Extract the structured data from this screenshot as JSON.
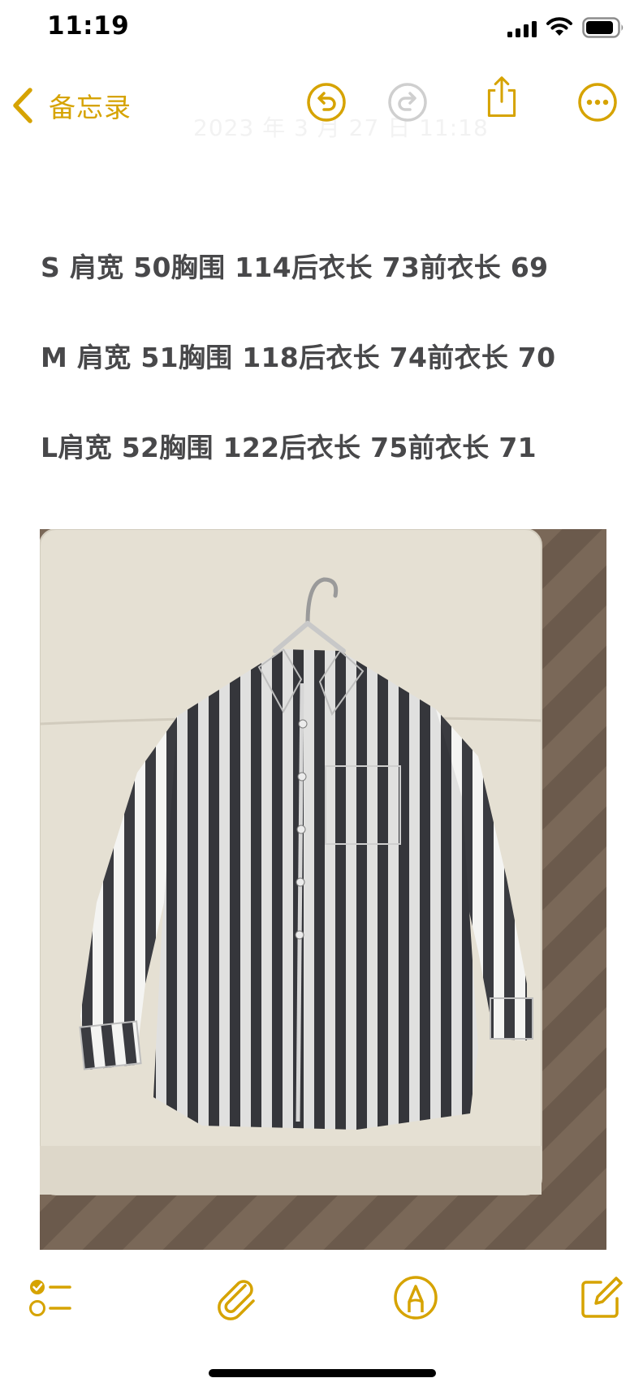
{
  "status_bar": {
    "time": "11:19",
    "icons": [
      "cellular-signal-icon",
      "wifi-icon",
      "battery-icon"
    ]
  },
  "nav": {
    "back_label": "备忘录",
    "faded_date": "2023 年 3 月 27 日 11:18",
    "icons": [
      "chevron-left-icon",
      "undo-icon",
      "redo-icon",
      "share-icon",
      "more-icon"
    ]
  },
  "note": {
    "lines": [
      "S 肩宽 50胸围 114后衣长 73前衣长 69",
      "M 肩宽 51胸围 118后衣长 74前衣长 70",
      "L肩宽 52胸围 122后衣长 75前衣长 71"
    ]
  },
  "photo": {
    "subject": "striped-shirt-photo"
  },
  "toolbar": {
    "icons": [
      "checklist-icon",
      "paperclip-icon",
      "markup-pen-icon",
      "compose-icon"
    ]
  },
  "colors": {
    "accent": "#d6a300",
    "text": "#48484a",
    "background": "#ffffff",
    "redo_disabled": "#cfcfcf",
    "stripe_dark": "#3a3b40",
    "stripe_light": "#f4f4f2"
  }
}
